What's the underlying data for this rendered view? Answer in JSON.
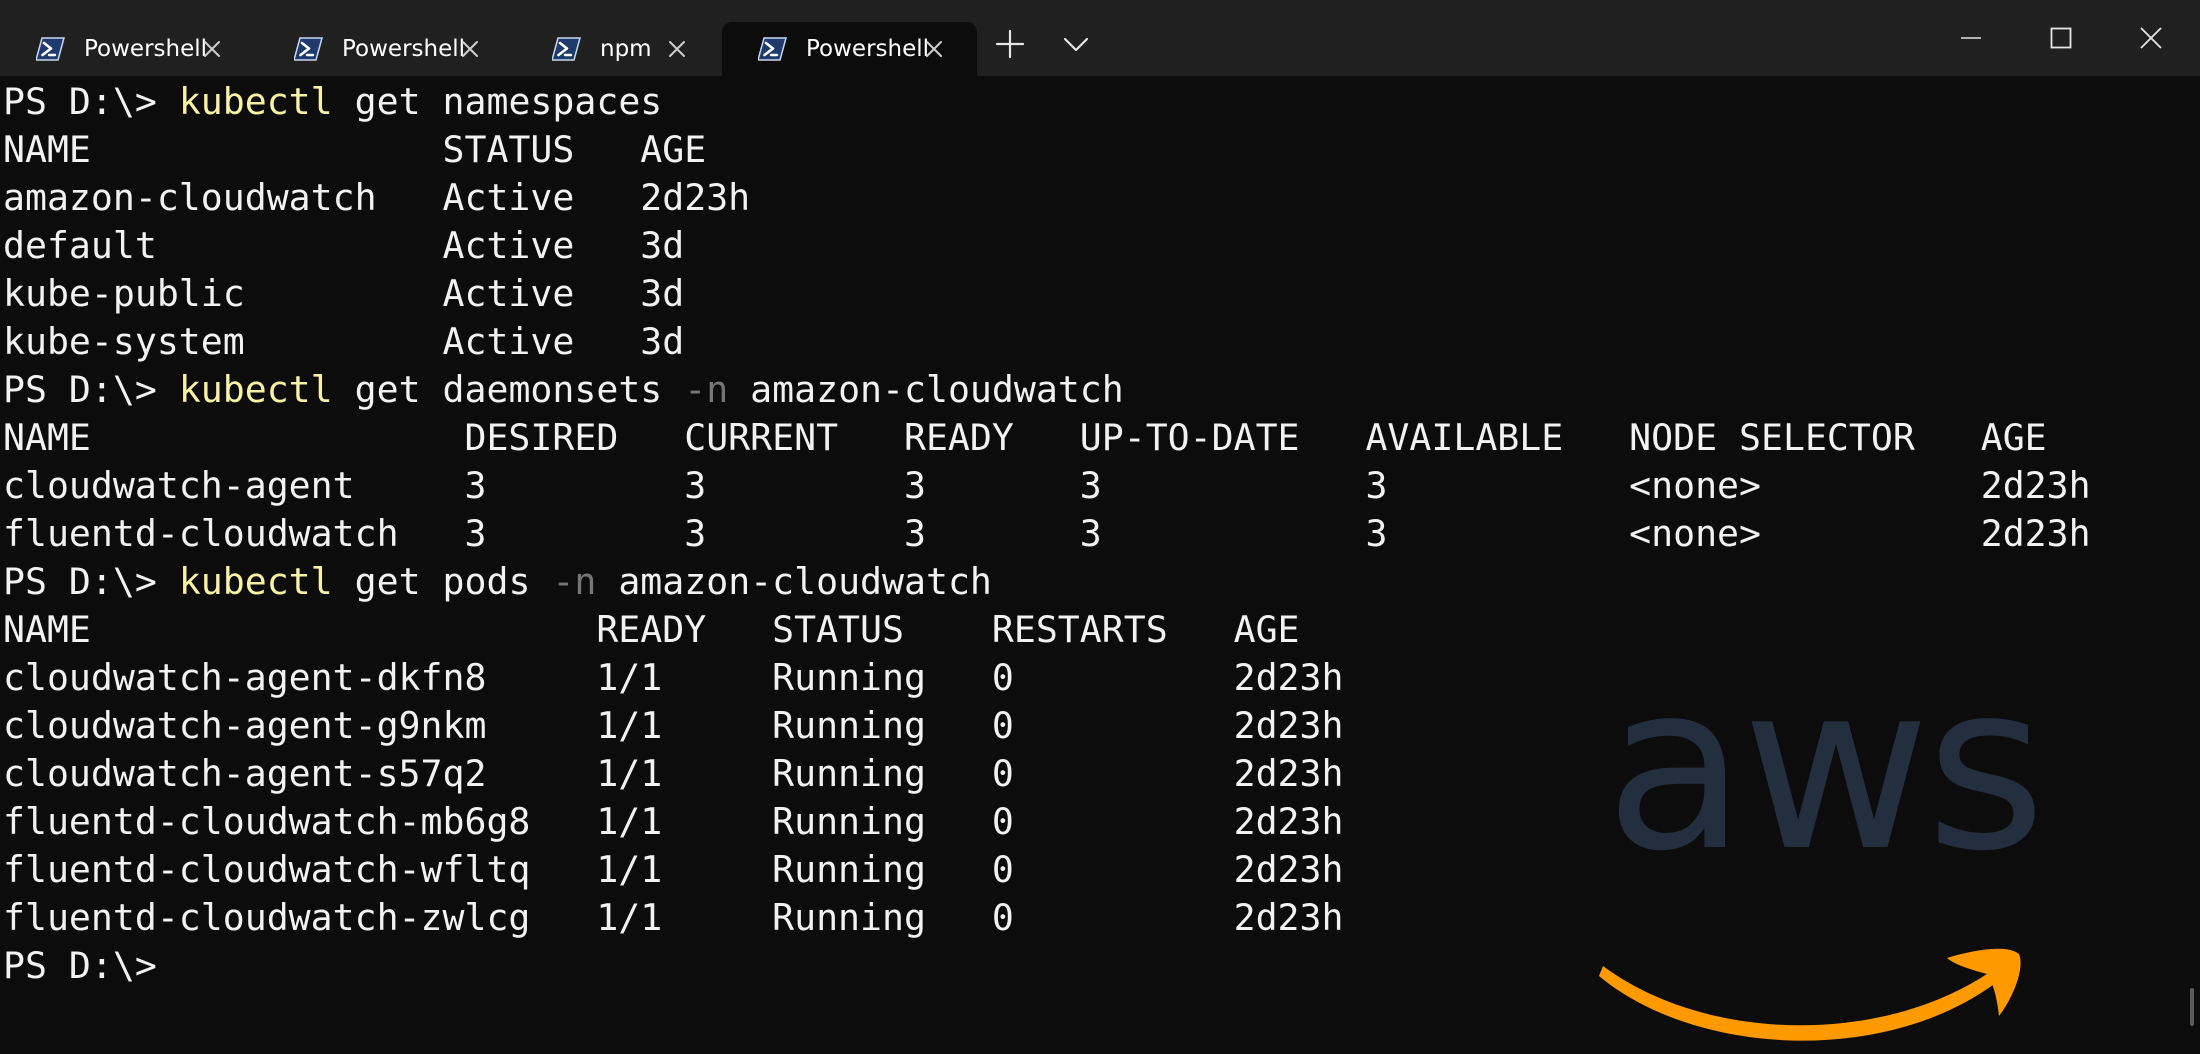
{
  "tabs": [
    {
      "label": "Powershell",
      "icon": "powershell-icon",
      "active": false
    },
    {
      "label": "Powershell",
      "icon": "powershell-icon",
      "active": false
    },
    {
      "label": "npm",
      "icon": "powershell-icon",
      "active": false
    },
    {
      "label": "Powershell",
      "icon": "powershell-icon",
      "active": true
    }
  ],
  "titlebar": {
    "new_tab_icon": "plus-icon",
    "dropdown_icon": "chevron-down-icon",
    "minimize_icon": "minimize-icon",
    "maximize_icon": "maximize-icon",
    "close_icon": "close-icon"
  },
  "terminal": {
    "lines": [
      [
        {
          "t": "PS D:\\> ",
          "s": "text"
        },
        {
          "t": "kubectl",
          "s": "cmd"
        },
        {
          "t": " get namespaces",
          "s": "text"
        }
      ],
      [
        {
          "t": "NAME                STATUS   AGE",
          "s": "text"
        }
      ],
      [
        {
          "t": "amazon-cloudwatch   Active   2d23h",
          "s": "text"
        }
      ],
      [
        {
          "t": "default             Active   3d",
          "s": "text"
        }
      ],
      [
        {
          "t": "kube-public         Active   3d",
          "s": "text"
        }
      ],
      [
        {
          "t": "kube-system         Active   3d",
          "s": "text"
        }
      ],
      [
        {
          "t": "PS D:\\> ",
          "s": "text"
        },
        {
          "t": "kubectl",
          "s": "cmd"
        },
        {
          "t": " get daemonsets ",
          "s": "text"
        },
        {
          "t": "-n",
          "s": "flag"
        },
        {
          "t": " amazon-cloudwatch",
          "s": "text"
        }
      ],
      [
        {
          "t": "NAME                 DESIRED   CURRENT   READY   UP-TO-DATE   AVAILABLE   NODE SELECTOR   AGE",
          "s": "text"
        }
      ],
      [
        {
          "t": "cloudwatch-agent     3         3         3       3            3           <none>          2d23h",
          "s": "text"
        }
      ],
      [
        {
          "t": "fluentd-cloudwatch   3         3         3       3            3           <none>          2d23h",
          "s": "text"
        }
      ],
      [
        {
          "t": "PS D:\\> ",
          "s": "text"
        },
        {
          "t": "kubectl",
          "s": "cmd"
        },
        {
          "t": " get pods ",
          "s": "text"
        },
        {
          "t": "-n",
          "s": "flag"
        },
        {
          "t": " amazon-cloudwatch",
          "s": "text"
        }
      ],
      [
        {
          "t": "NAME                       READY   STATUS    RESTARTS   AGE",
          "s": "text"
        }
      ],
      [
        {
          "t": "cloudwatch-agent-dkfn8     1/1     Running   0          2d23h",
          "s": "text"
        }
      ],
      [
        {
          "t": "cloudwatch-agent-g9nkm     1/1     Running   0          2d23h",
          "s": "text"
        }
      ],
      [
        {
          "t": "cloudwatch-agent-s57q2     1/1     Running   0          2d23h",
          "s": "text"
        }
      ],
      [
        {
          "t": "fluentd-cloudwatch-mb6g8   1/1     Running   0          2d23h",
          "s": "text"
        }
      ],
      [
        {
          "t": "fluentd-cloudwatch-wfltq   1/1     Running   0          2d23h",
          "s": "text"
        }
      ],
      [
        {
          "t": "fluentd-cloudwatch-zwlcg   1/1     Running   0          2d23h",
          "s": "text"
        }
      ],
      [
        {
          "t": "PS D:\\>",
          "s": "text"
        }
      ]
    ]
  },
  "logo": {
    "text": "aws",
    "text_color": "#232f3e",
    "smile_color": "#ff9900"
  },
  "colors": {
    "background": "#0c0c0c",
    "tabbar": "#202020",
    "foreground": "#f2f2f2",
    "command": "#f9f1a5",
    "flag": "#767676"
  }
}
